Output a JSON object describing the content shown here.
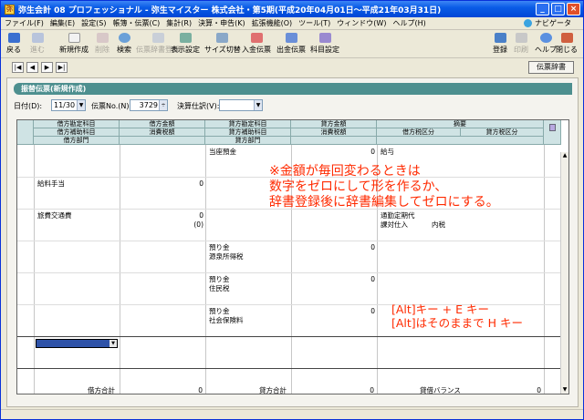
{
  "window": {
    "title": "弥生会計 08 プロフェッショナル - 弥生マイスター 株式会社・第5期(平成20年04月01日～平成21年03月31日)",
    "icon_label": "弥"
  },
  "menu": {
    "items": [
      "ファイル(F)",
      "編集(E)",
      "設定(S)",
      "帳簿・伝票(C)",
      "集計(R)",
      "決算・申告(K)",
      "拡張機能(O)",
      "ツール(T)",
      "ウィンドウ(W)",
      "ヘルプ(H)"
    ],
    "navigator": "ナビゲータ"
  },
  "toolbar": {
    "back": "戻る",
    "forward": "進む",
    "new": "新規作成",
    "delete": "削除",
    "search": "検索",
    "dictionary": "伝票辞書登録",
    "display_settings": "表示設定",
    "size_toggle": "サイズ切替",
    "deposit_slip": "入金伝票",
    "payment_slip": "出金伝票",
    "account_settings": "科目設定",
    "register": "登録",
    "print": "印刷",
    "help": "ヘルプ",
    "close": "閉じる"
  },
  "nav": {
    "first": "|◀",
    "prev": "◀",
    "next": "▶",
    "last": "▶|",
    "dict_button": "伝票辞書"
  },
  "form": {
    "header": "振替伝票(新規作成)",
    "date_label": "日付(D):",
    "date_value": "11/30",
    "slip_no_label": "伝票No.(N):",
    "slip_no_value": "3729",
    "settlement_label": "決算仕訳(V):",
    "settlement_value": ""
  },
  "columns": {
    "row1": [
      "借方勘定科目",
      "借方金額",
      "貸方勘定科目",
      "貸方金額",
      "摘要"
    ],
    "row2": [
      "借方補助科目",
      "消費税額",
      "貸方補助科目",
      "消費税額",
      "借方税区分",
      "貸方税区分"
    ],
    "row3": [
      "借方部門",
      "貸方部門"
    ]
  },
  "rows": {
    "r1_credit_account": "当座預金",
    "r1_credit_amount": "0",
    "r1_summary": "給与",
    "r2_debit_account": "給料手当",
    "r2_debit_amount": "0",
    "r3_debit_account": "旅費交通費",
    "r3_debit_amount": "0",
    "r3_debit_tax": "(0)",
    "r3_summary": "通勤定期代",
    "r3_tax_class": "課対仕入",
    "r3_tax_type": "内税",
    "r4_credit_account": "預り金",
    "r4_credit_amount": "0",
    "r4_credit_sub": "源泉所得税",
    "r5_credit_account": "預り金",
    "r5_credit_amount": "0",
    "r5_credit_sub": "住民税",
    "r6_credit_account": "預り金",
    "r6_credit_amount": "0",
    "r6_credit_sub": "社会保険料"
  },
  "footer": {
    "debit_total_label": "借方合計",
    "debit_total": "0",
    "credit_total_label": "貸方合計",
    "credit_total": "0",
    "balance_label": "貸借バランス",
    "balance": "0"
  },
  "annotations": {
    "note_line1": "※金額が毎回変わるときは",
    "note_line2": "数字をゼロにして形を作るか、",
    "note_line3": "辞書登録後に辞書編集してゼロにする。",
    "key_line1": "[Alt]キー + E キー",
    "key_line2": "[Alt]はそのままで H キー"
  },
  "colors": {
    "annotation": "#ff2a00",
    "header_bar": "#4d8f8f",
    "column_header": "#cfe3e4",
    "title_bar": "#0a5ce6"
  }
}
